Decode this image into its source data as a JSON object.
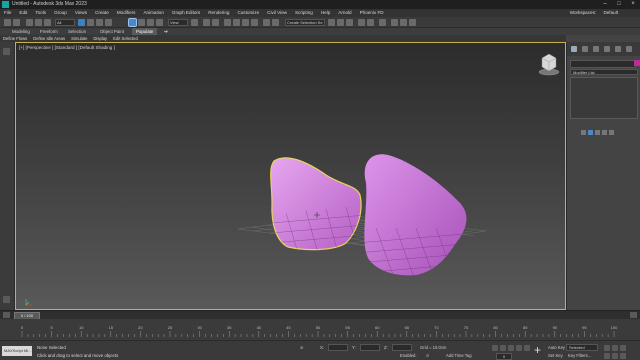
{
  "window": {
    "title": "Untitled - Autodesk 3ds Max 2023"
  },
  "menu": {
    "items": [
      "File",
      "Edit",
      "Tools",
      "Group",
      "Views",
      "Create",
      "Modifiers",
      "Animation",
      "Graph Editors",
      "Rendering",
      "Customize",
      "Civil View",
      "Scripting",
      "Help",
      "Arnold",
      "Phoenix FD"
    ],
    "workspaces_label": "Workspaces:",
    "workspace_value": "Default"
  },
  "toolbar": {
    "filter_value": "All",
    "view_value": "View",
    "selection_set_placeholder": "Create Selection Se"
  },
  "ribbon": {
    "tabs": [
      "Modeling",
      "Freeform",
      "Selection",
      "Object Paint",
      "Populate"
    ],
    "active_tab": "Populate",
    "subtabs": [
      "Define Flows",
      "Define Idle Areas",
      "Simulate",
      "Display",
      "Edit Selected"
    ]
  },
  "viewport": {
    "label": "[+] [Perspective ] [Standard ] [Default Shading ]",
    "object_color": "#d58ce0",
    "selection_color": "#e8d45c"
  },
  "command_panel": {
    "modifier_list_label": "Modifier List",
    "object_color": "#c12a9a"
  },
  "time_slider": {
    "value": "0 / 100",
    "ticks": [
      "0",
      "5",
      "10",
      "15",
      "20",
      "25",
      "30",
      "35",
      "40",
      "45",
      "50",
      "55",
      "60",
      "65",
      "70",
      "75",
      "80",
      "85",
      "90",
      "95",
      "100"
    ]
  },
  "status": {
    "maxscript": "MAXScript Mi...",
    "selection": "None Selected",
    "prompt": "Click and drag to select and move objects",
    "grid": "Grid = 10.0cm",
    "x_label": "X:",
    "y_label": "Y:",
    "z_label": "Z:",
    "enabled_label": "Enabled:",
    "add_time_tag": "Add Time Tag",
    "auto_key": "Auto Key",
    "set_key": "Set Key",
    "selected_value": "Selected",
    "key_filters": "Key Filters...",
    "frame": "0"
  }
}
